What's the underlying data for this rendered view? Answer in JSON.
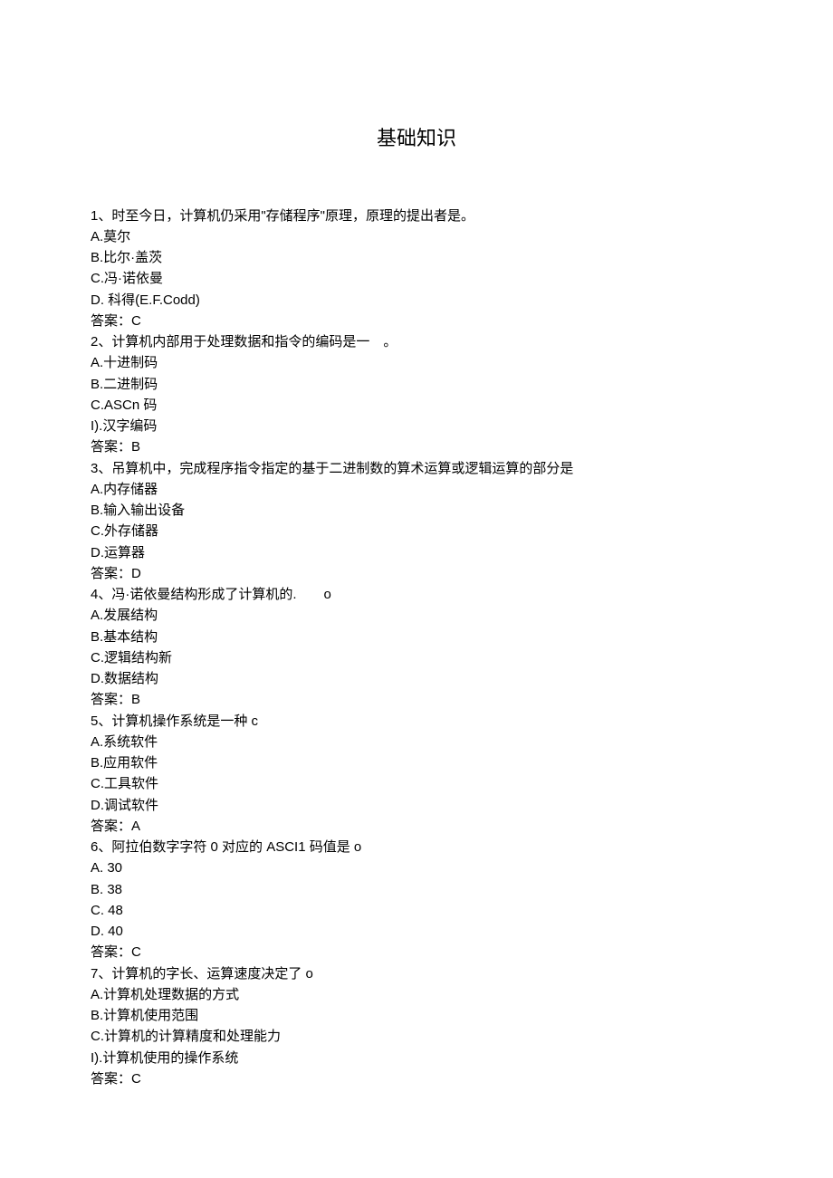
{
  "title": "基础知识",
  "lines": [
    "1、时至今日，计算机仍采用\"存储程序\"原理，原理的提出者是。",
    "A.莫尔",
    "B.比尔·盖茨",
    "C.冯·诺依曼",
    "D. 科得(E.F.Codd)",
    "答案：C",
    "2、计算机内部用于处理数据和指令的编码是一　。",
    "A.十进制码",
    "B.二进制码",
    "C.ASCn 码",
    "I).汉字编码",
    "答案：B",
    "3、吊算机中，完成程序指令指定的基于二进制数的算术运算或逻辑运算的部分是",
    "A.内存储器",
    "B.输入输出设备",
    "C.外存储器",
    "D.运算器",
    "答案：D",
    "4、冯·诺依曼结构形成了计算机的.　　o",
    "A.发展结构",
    "B.基本结构",
    "C.逻辑结构新",
    "D.数据结构",
    "答案：B",
    "5、计算机操作系统是一种 c",
    "A.系统软件",
    "B.应用软件",
    "C.工具软件",
    "D.调试软件",
    "答案：A",
    "6、阿拉伯数字字符 0 对应的 ASCI1 码值是 o",
    "A.   30",
    "B.   38",
    "C.   48",
    "D.   40",
    "答案：C",
    "7、计算机的字长、运算速度决定了 o",
    "A.计算机处理数据的方式",
    "B.计算机使用范围",
    "C.计算机的计算精度和处理能力",
    "I).计算机使用的操作系统",
    "答案：C"
  ]
}
